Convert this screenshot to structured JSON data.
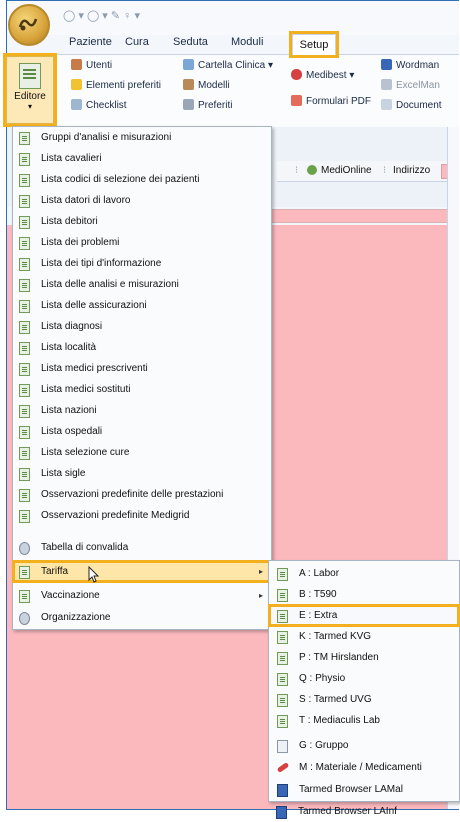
{
  "ribbon_tabs": [
    "Paziente",
    "Cura",
    "Seduta",
    "Moduli",
    "Setup"
  ],
  "ribbon": {
    "editore_label": "Editore",
    "col1": [
      "Utenti",
      "Elementi preferiti",
      "Checklist"
    ],
    "col2": [
      "Cartella Clinica",
      "Modelli",
      "Preferiti"
    ],
    "col3": [
      "Medibest",
      "Formulari PDF"
    ],
    "col4": [
      "Wordman",
      "ExcelMan",
      "Document"
    ]
  },
  "toolbar": {
    "medionline": "MediOnline",
    "indirizzo": "Indirizzo"
  },
  "menu_items": [
    "Gruppi d'analisi e misurazioni",
    "Lista cavalieri",
    "Lista codici di selezione dei pazienti",
    "Lista datori di lavoro",
    "Lista debitori",
    "Lista dei problemi",
    "Lista dei tipi d'informazione",
    "Lista delle analisi e misurazioni",
    "Lista delle assicurazioni",
    "Lista diagnosi",
    "Lista località",
    "Lista medici prescriventi",
    "Lista medici sostituti",
    "Lista nazioni",
    "Lista ospedali",
    "Lista selezione cure",
    "Lista sigle",
    "Osservazioni predefinite delle prestazioni",
    "Osservazioni predefinite Medigrid",
    "Tabella di convalida",
    "Tariffa",
    "Vaccinazione",
    "Organizzazione"
  ],
  "submenu_items": [
    "A : Labor",
    "B : T590",
    "E : Extra",
    "K : Tarmed KVG",
    "P : TM Hirslanden",
    "Q : Physio",
    "S : Tarmed UVG",
    "T : Mediaculis Lab",
    "G : Gruppo",
    "M : Materiale / Medicamenti",
    "Tarmed Browser LAMal",
    "Tarmed Browser LAInf"
  ],
  "submenu_arrow": "▸",
  "colors": {
    "highlight": "#f2b01e",
    "pink_pane": "#fbb8bd",
    "accent": "#2f6fb5"
  },
  "icons": [
    "app-orb-icon",
    "page-icon",
    "gear-icon",
    "pill-icon",
    "grid-icon",
    "cursor-icon"
  ]
}
